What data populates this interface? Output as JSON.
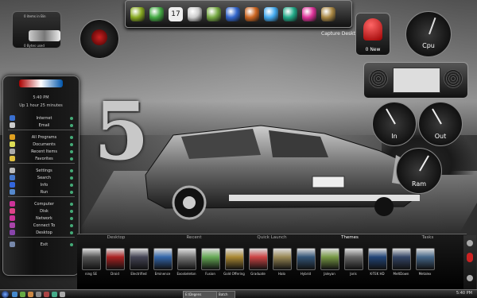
{
  "dock": {
    "label": "Capture Desktop",
    "icons": [
      {
        "name": "nvidia-icon",
        "color": "#88aa22"
      },
      {
        "name": "refresh-icon",
        "color": "#44aa44"
      },
      {
        "name": "calendar-icon",
        "color": "#dddddd"
      },
      {
        "name": "document-icon",
        "color": "#cccccc"
      },
      {
        "name": "tool-icon",
        "color": "#77aa44"
      },
      {
        "name": "globe-icon",
        "color": "#3366cc"
      },
      {
        "name": "firefox-icon",
        "color": "#cc6622"
      },
      {
        "name": "messenger-icon",
        "color": "#44aaee"
      },
      {
        "name": "network-icon",
        "color": "#22aa88"
      },
      {
        "name": "pink-app-icon",
        "color": "#dd3399"
      },
      {
        "name": "media-icon",
        "color": "#aa8844"
      }
    ],
    "calendar_day": "17"
  },
  "recycle_widget": {
    "line1": "0 items in Bin",
    "line2": "0 Bytes used"
  },
  "mail_widget": {
    "label": "0 New"
  },
  "cpu_gauge": {
    "label": "Cpu"
  },
  "in_gauge": {
    "label": "In"
  },
  "out_gauge": {
    "label": "Out"
  },
  "ram_gauge": {
    "label": "Ram"
  },
  "sidebar": {
    "time": "5:40 PM",
    "uptime": "Up 1 hour 25 minutes",
    "groups": [
      [
        {
          "label": "Internet",
          "icon": "globe-icon",
          "color": "#3a70d0"
        },
        {
          "label": "Email",
          "icon": "mail-icon",
          "color": "#cccccc"
        }
      ],
      [
        {
          "label": "All Programs",
          "icon": "programs-icon",
          "color": "#e0a020"
        },
        {
          "label": "Documents",
          "icon": "documents-icon",
          "color": "#dddd55"
        },
        {
          "label": "Recent Items",
          "icon": "recent-icon",
          "color": "#aaaaaa"
        },
        {
          "label": "Favorites",
          "icon": "favorites-icon",
          "color": "#e0c040"
        }
      ],
      [
        {
          "label": "Settings",
          "icon": "settings-icon",
          "color": "#bbbbbb"
        },
        {
          "label": "Search",
          "icon": "search-icon",
          "color": "#4477cc"
        },
        {
          "label": "Info",
          "icon": "info-icon",
          "color": "#3366dd"
        },
        {
          "label": "Run",
          "icon": "run-icon",
          "color": "#5588cc"
        }
      ],
      [
        {
          "label": "Computer",
          "icon": "computer-icon",
          "color": "#cc3399"
        },
        {
          "label": "Disk",
          "icon": "disk-icon",
          "color": "#dd4488"
        },
        {
          "label": "Network",
          "icon": "network-icon",
          "color": "#cc3399"
        },
        {
          "label": "Connect To",
          "icon": "connect-icon",
          "color": "#aa44aa"
        },
        {
          "label": "Desktop",
          "icon": "desktop-icon",
          "color": "#8844aa"
        }
      ],
      [
        {
          "label": "Exit",
          "icon": "exit-icon",
          "color": "#7788aa"
        }
      ]
    ]
  },
  "launcher": {
    "tabs": [
      {
        "label": "Desktop",
        "active": false
      },
      {
        "label": "Recent",
        "active": false
      },
      {
        "label": "Quick Launch",
        "active": false
      },
      {
        "label": "Themes",
        "active": true
      },
      {
        "label": "Tasks",
        "active": false
      }
    ],
    "themes": [
      {
        "label": "ning SE",
        "color": "#555555"
      },
      {
        "label": "Droid",
        "color": "#aa2222"
      },
      {
        "label": "Electrified",
        "color": "#444455"
      },
      {
        "label": "Eminence",
        "color": "#3366aa"
      },
      {
        "label": "Exoskeleton",
        "color": "#777777"
      },
      {
        "label": "Fusion",
        "color": "#66aa55"
      },
      {
        "label": "Gold Offering",
        "color": "#aa8833"
      },
      {
        "label": "Graduate",
        "color": "#cc4444"
      },
      {
        "label": "Halo",
        "color": "#998855"
      },
      {
        "label": "Hybrid",
        "color": "#335577"
      },
      {
        "label": "Jaleyan",
        "color": "#779944"
      },
      {
        "label": "Joris",
        "color": "#666666"
      },
      {
        "label": "K-TEK HD",
        "color": "#224477"
      },
      {
        "label": "MeltDown",
        "color": "#334466"
      },
      {
        "label": "Metalex",
        "color": "#446688"
      }
    ]
  },
  "taskbar": {
    "task1": "E:\\Degens",
    "task2": "Batch",
    "clock": "5:40 PM"
  },
  "wallpaper_text": "5"
}
